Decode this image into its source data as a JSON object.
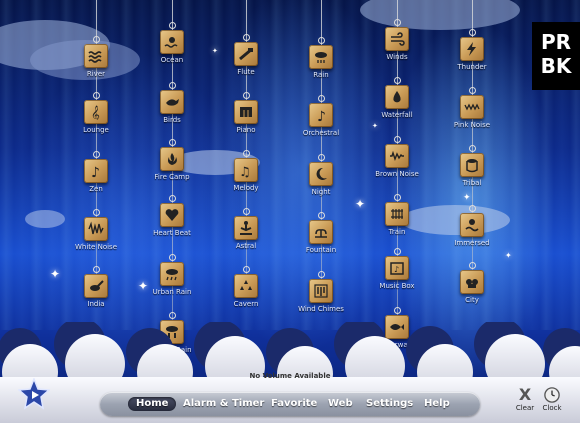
{
  "logo": {
    "line1": "PR",
    "line2": "BK"
  },
  "sounds": [
    {
      "name": "River",
      "icon": "waves-icon"
    },
    {
      "name": "Lounge",
      "icon": "treble-clef-icon"
    },
    {
      "name": "Zen",
      "icon": "music-note-icon"
    },
    {
      "name": "White Noise",
      "icon": "noise-wave-icon"
    },
    {
      "name": "India",
      "icon": "sitar-icon"
    },
    {
      "name": "Ocean",
      "icon": "ocean-sun-icon"
    },
    {
      "name": "Birds",
      "icon": "bird-icon"
    },
    {
      "name": "Fire Camp",
      "icon": "campfire-icon"
    },
    {
      "name": "Heart Beat",
      "icon": "heart-icon"
    },
    {
      "name": "Urban Rain",
      "icon": "urban-rain-icon"
    },
    {
      "name": "Forest Rain",
      "icon": "forest-rain-icon"
    },
    {
      "name": "Flute",
      "icon": "flute-icon"
    },
    {
      "name": "Piano",
      "icon": "piano-icon"
    },
    {
      "name": "Melody",
      "icon": "melody-notes-icon"
    },
    {
      "name": "Astral",
      "icon": "meditation-icon"
    },
    {
      "name": "Cavern",
      "icon": "cavern-drops-icon"
    },
    {
      "name": "Rain",
      "icon": "rain-cloud-icon"
    },
    {
      "name": "Orchestral",
      "icon": "eighth-note-icon"
    },
    {
      "name": "Night",
      "icon": "moon-icon"
    },
    {
      "name": "Fountain",
      "icon": "fountain-icon"
    },
    {
      "name": "Wind Chimes",
      "icon": "wind-chimes-icon"
    },
    {
      "name": "Winds",
      "icon": "wind-icon"
    },
    {
      "name": "Waterfall",
      "icon": "water-drop-icon"
    },
    {
      "name": "Brown Noise",
      "icon": "brown-noise-icon"
    },
    {
      "name": "Train",
      "icon": "train-tracks-icon"
    },
    {
      "name": "Music Box",
      "icon": "music-box-icon"
    },
    {
      "name": "Underwater",
      "icon": "fish-icon"
    },
    {
      "name": "Thunder",
      "icon": "lightning-icon"
    },
    {
      "name": "Pink Noise",
      "icon": "pink-noise-icon"
    },
    {
      "name": "Tribal",
      "icon": "drum-icon"
    },
    {
      "name": "Immersed",
      "icon": "immersed-icon"
    },
    {
      "name": "City",
      "icon": "city-icon"
    }
  ],
  "status": {
    "volume_text": "No Volume Available"
  },
  "tabs": [
    {
      "label": "Home",
      "active": true
    },
    {
      "label": "Alarm & Timer",
      "active": false
    },
    {
      "label": "Favorite",
      "active": false
    },
    {
      "label": "Web",
      "active": false
    },
    {
      "label": "Settings",
      "active": false
    },
    {
      "label": "Help",
      "active": false
    }
  ],
  "controls": {
    "clear_label": "Clear",
    "clock_label": "Clock",
    "clear_glyph": "X"
  },
  "colors": {
    "tile": "#c99a55",
    "sky": "#1a4fd0",
    "tabbar": "#9ca3b1"
  }
}
